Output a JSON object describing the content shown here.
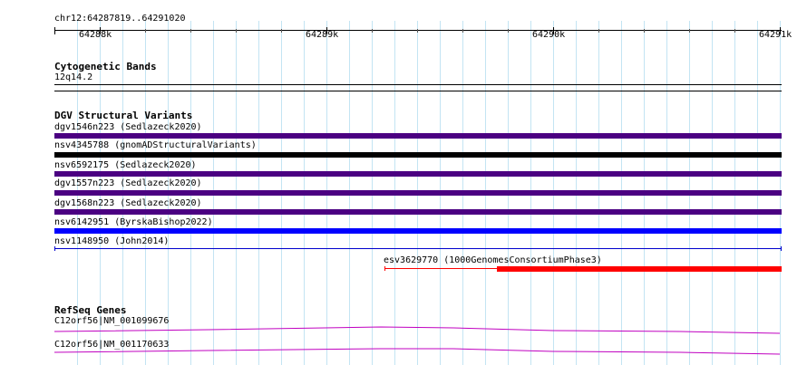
{
  "region": "chr12:64287819..64291020",
  "ruler": {
    "ticks": [
      {
        "label": "64288k"
      },
      {
        "label": "64289k"
      },
      {
        "label": "64290k"
      },
      {
        "label": "64291k"
      }
    ]
  },
  "tracks": {
    "cytobands": {
      "title": "Cytogenetic Bands",
      "band": "12q14.2"
    },
    "dgv": {
      "title": "DGV Structural Variants",
      "variants": [
        {
          "label": "dgv1546n223 (Sedlazeck2020)",
          "color": "#4b0082"
        },
        {
          "label": "nsv4345788 (gnomADStructuralVariants)",
          "color": "#000000"
        },
        {
          "label": "nsv6592175 (Sedlazeck2020)",
          "color": "#4b0082"
        },
        {
          "label": "dgv1557n223 (Sedlazeck2020)",
          "color": "#4b0082"
        },
        {
          "label": "dgv1568n223 (Sedlazeck2020)",
          "color": "#4b0082"
        },
        {
          "label": "nsv6142951 (ByrskaBishop2022)",
          "color": "#0000ff"
        },
        {
          "label": "nsv1148950 (John2014)",
          "color": "#0000cd"
        },
        {
          "label": "esv3629770 (1000GenomesConsortiumPhase3)",
          "color": "#ff0000"
        }
      ]
    },
    "refseq": {
      "title": "RefSeq Genes",
      "genes": [
        {
          "label": "C12orf56|NM_001099676",
          "color": "#c000c0"
        },
        {
          "label": "C12orf56|NM_001170633",
          "color": "#c000c0"
        }
      ]
    }
  }
}
